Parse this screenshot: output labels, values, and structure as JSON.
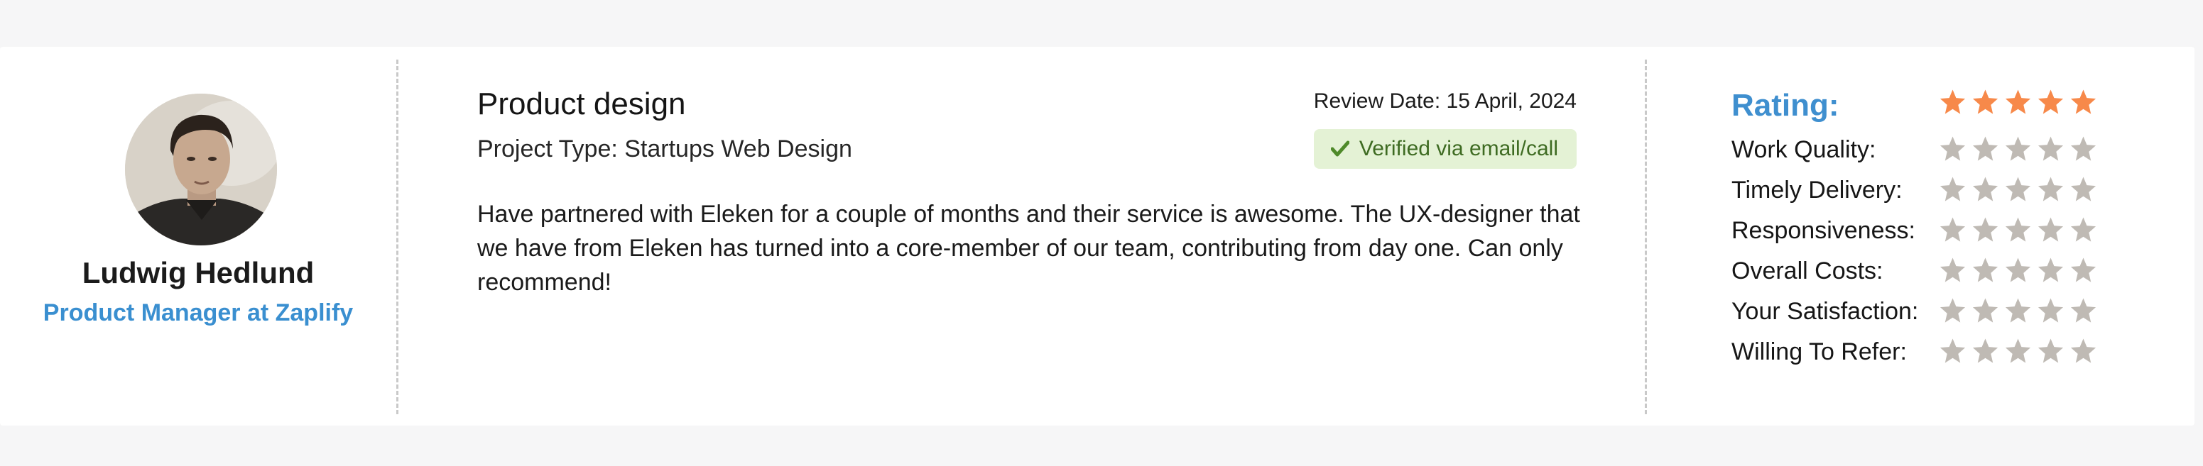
{
  "reviewer": {
    "name": "Ludwig Hedlund",
    "title": "Product Manager at Zaplify"
  },
  "review": {
    "title": "Product design",
    "project_type": "Project Type: Startups Web Design",
    "date": "Review Date: 15 April, 2024",
    "verified": "Verified via email/call",
    "text": "Have partnered with Eleken for a couple of months and their service is awesome. The UX-designer that we have from Eleken has turned into a core-member of our team, contributing from day one. Can only recommend!"
  },
  "ratings": {
    "heading": "Rating:",
    "overall_stars": 5,
    "items": [
      {
        "label": "Work Quality:",
        "stars": 0
      },
      {
        "label": "Timely Delivery:",
        "stars": 0
      },
      {
        "label": "Responsiveness:",
        "stars": 0
      },
      {
        "label": "Overall Costs:",
        "stars": 0
      },
      {
        "label": "Your Satisfaction:",
        "stars": 0
      },
      {
        "label": "Willing To Refer:",
        "stars": 0
      }
    ]
  },
  "colors": {
    "accent_blue": "#3f8fcf",
    "star_active": "#f7894a",
    "star_inactive": "#bfbab4",
    "verified_bg": "#e4f2d5"
  },
  "icons": {
    "verified": "check-icon",
    "rating": "star-icon"
  }
}
